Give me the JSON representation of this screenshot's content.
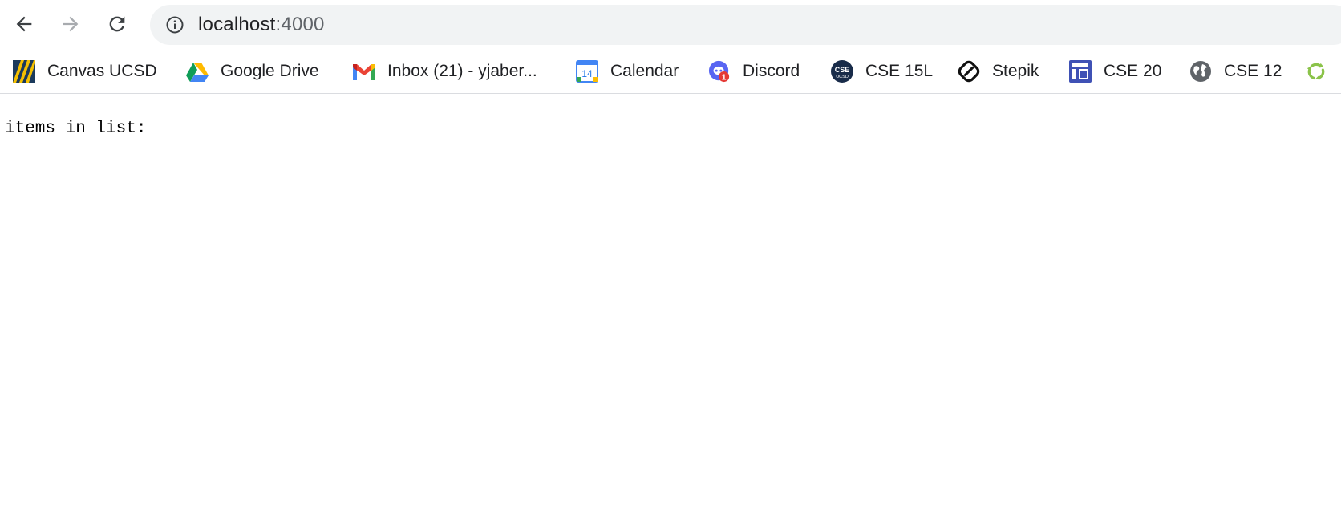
{
  "browser": {
    "address": {
      "host": "localhost",
      "port": ":4000"
    }
  },
  "bookmarks": [
    {
      "label": "Canvas UCSD",
      "icon": "canvas-icon"
    },
    {
      "label": "Google Drive",
      "icon": "google-drive-icon"
    },
    {
      "label": "Inbox (21) - yjaber...",
      "icon": "gmail-icon"
    },
    {
      "label": "Calendar",
      "icon": "calendar-icon"
    },
    {
      "label": "Discord",
      "icon": "discord-icon"
    },
    {
      "label": "CSE 15L",
      "icon": "cse-ucsd-icon"
    },
    {
      "label": "Stepik",
      "icon": "stepik-icon"
    },
    {
      "label": "CSE 20",
      "icon": "website-icon"
    },
    {
      "label": "CSE 12",
      "icon": "globe-icon"
    },
    {
      "label": "",
      "icon": "recycle-icon"
    }
  ],
  "page": {
    "text": "items in list:"
  },
  "colors": {
    "omnibox_bg": "#f1f3f4",
    "text": "#202124",
    "muted": "#5f6368",
    "divider": "#dadce0"
  }
}
